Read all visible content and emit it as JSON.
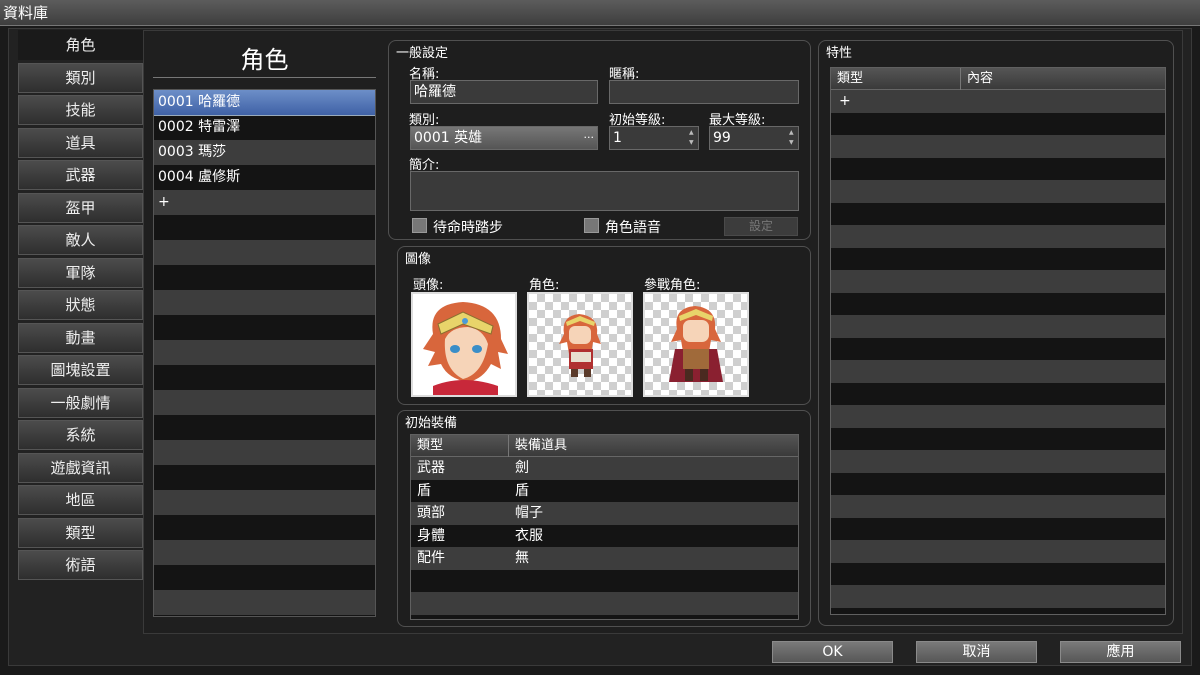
{
  "window": {
    "title": "資料庫"
  },
  "tabs": [
    {
      "label": "角色"
    },
    {
      "label": "類別"
    },
    {
      "label": "技能"
    },
    {
      "label": "道具"
    },
    {
      "label": "武器"
    },
    {
      "label": "盔甲"
    },
    {
      "label": "敵人"
    },
    {
      "label": "軍隊"
    },
    {
      "label": "狀態"
    },
    {
      "label": "動畫"
    },
    {
      "label": "圖塊設置"
    },
    {
      "label": "一般劇情"
    },
    {
      "label": "系統"
    },
    {
      "label": "遊戲資訊"
    },
    {
      "label": "地區"
    },
    {
      "label": "類型"
    },
    {
      "label": "術語"
    }
  ],
  "actors": {
    "heading": "角色",
    "items": [
      {
        "label": "0001 哈羅德"
      },
      {
        "label": "0002 特雷澤"
      },
      {
        "label": "0003 瑪莎"
      },
      {
        "label": "0004 盧修斯"
      }
    ],
    "add": "+"
  },
  "general": {
    "title": "一般設定",
    "name_label": "名稱:",
    "name_value": "哈羅德",
    "nickname_label": "暱稱:",
    "nickname_value": "",
    "class_label": "類別:",
    "class_value": "0001 英雄",
    "class_button": "···",
    "init_level_label": "初始等級:",
    "init_level_value": "1",
    "max_level_label": "最大等級:",
    "max_level_value": "99",
    "profile_label": "簡介:",
    "profile_value": "",
    "checkbox_step": "待命時踏步",
    "checkbox_voice": "角色語音",
    "settings_button": "設定"
  },
  "images": {
    "title": "圖像",
    "face_label": "頭像:",
    "character_label": "角色:",
    "battler_label": "參戰角色:"
  },
  "equipment": {
    "title": "初始裝備",
    "col_type": "類型",
    "col_item": "裝備道具",
    "rows": [
      {
        "type": "武器",
        "item": "劍"
      },
      {
        "type": "盾",
        "item": "盾"
      },
      {
        "type": "頭部",
        "item": "帽子"
      },
      {
        "type": "身體",
        "item": "衣服"
      },
      {
        "type": "配件",
        "item": "無"
      }
    ]
  },
  "traits": {
    "title": "特性",
    "col_type": "類型",
    "col_content": "內容",
    "add": "+"
  },
  "footer": {
    "ok": "OK",
    "cancel": "取消",
    "apply": "應用"
  },
  "colors": {
    "selection": "#4a6cb0",
    "row_alt": "#3d3d3d",
    "row_dark": "#141414"
  }
}
